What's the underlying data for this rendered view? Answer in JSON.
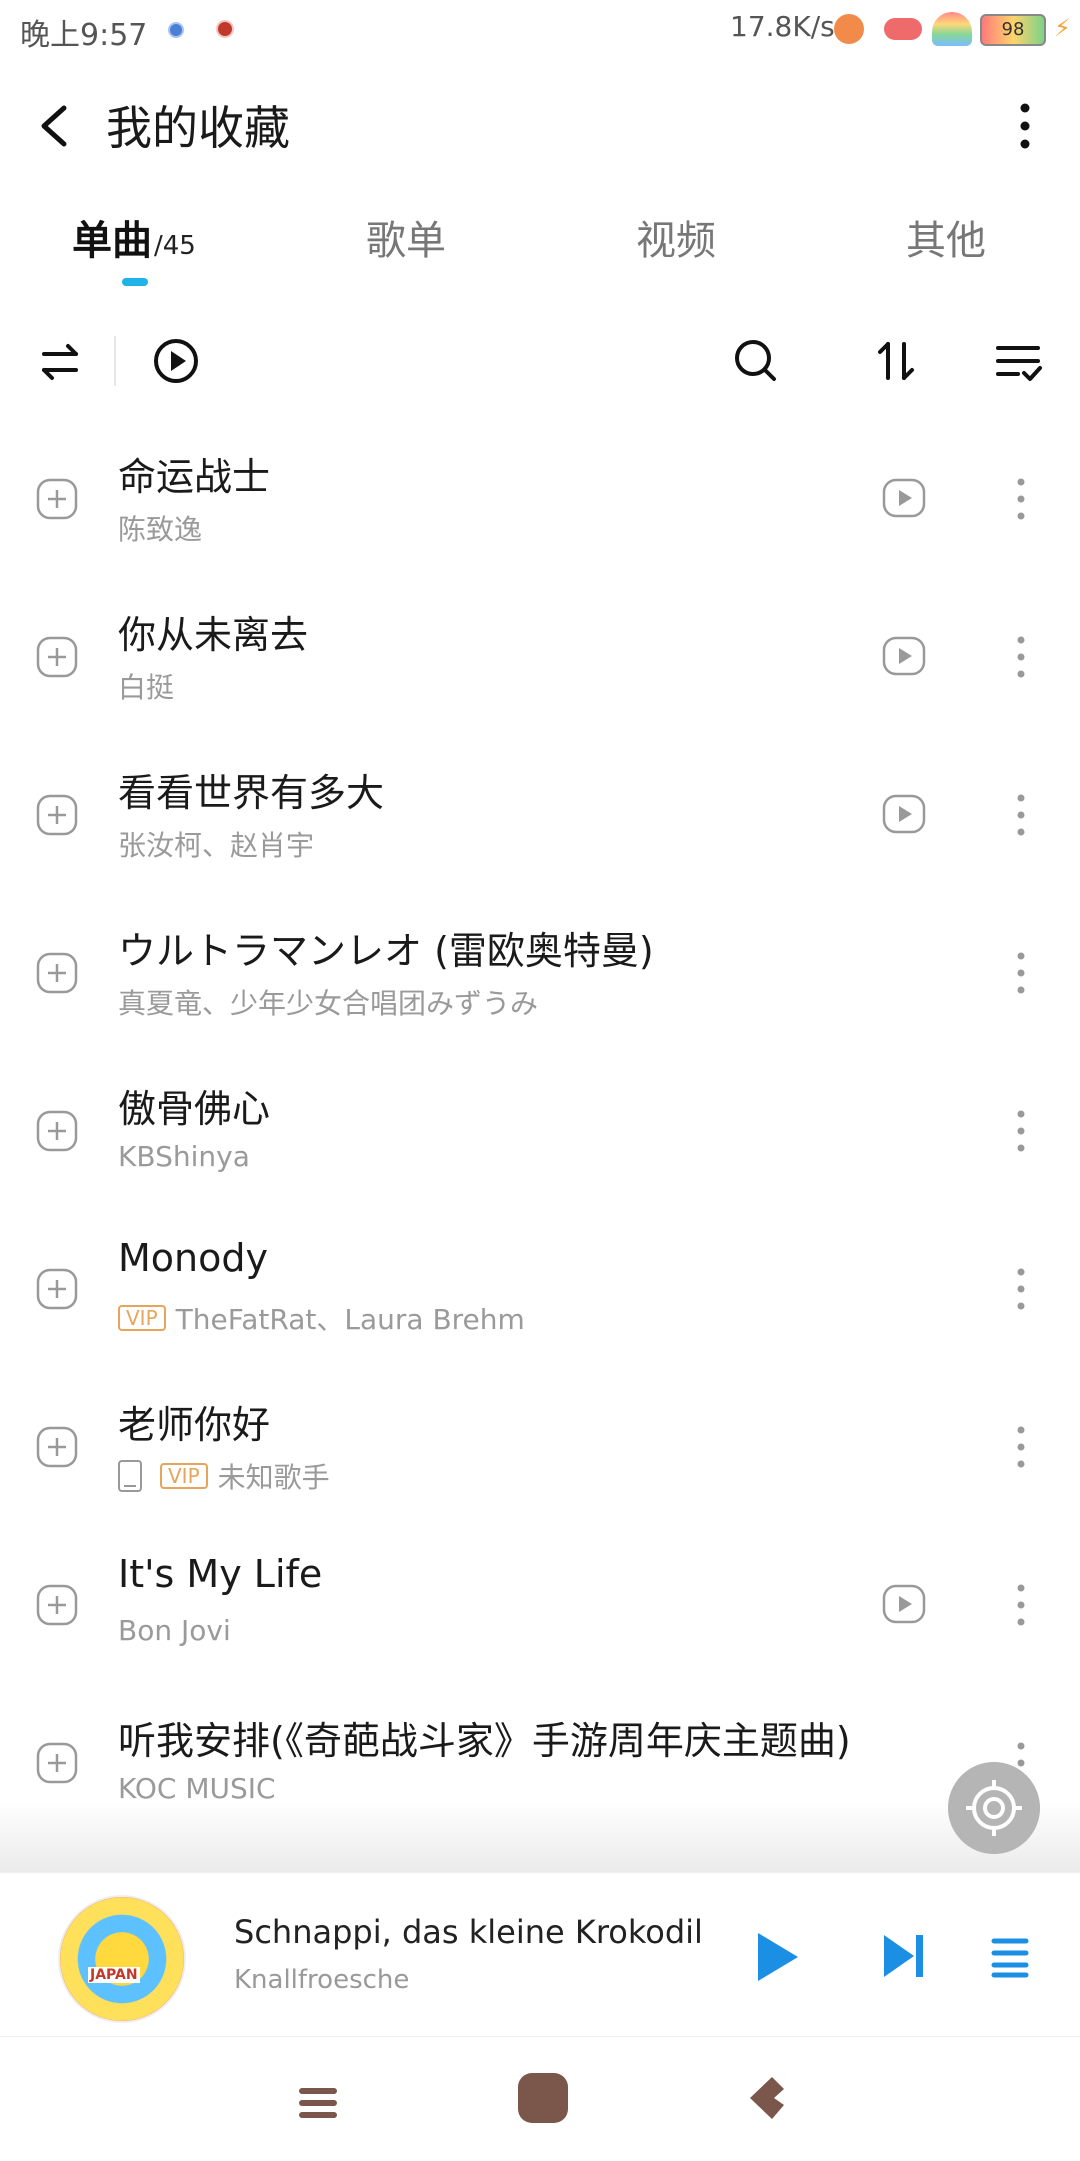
{
  "status_bar": {
    "time": "晚上9:57",
    "net_speed": "17.8K/s",
    "battery": "98"
  },
  "header": {
    "title": "我的收藏",
    "back_icon": "back-arrow-icon",
    "more_icon": "more-vertical-icon"
  },
  "tabs": [
    {
      "label": "单曲",
      "count": "/45",
      "active": true
    },
    {
      "label": "歌单"
    },
    {
      "label": "视频"
    },
    {
      "label": "其他"
    }
  ],
  "accent_color": "#1fb3e8",
  "toolbar": {
    "icons": [
      "shuffle-icon",
      "play-all-icon",
      "search-icon",
      "sort-icon",
      "multi-select-icon"
    ]
  },
  "songs": [
    {
      "title": "命运战士",
      "artist": "陈致逸",
      "has_mv": true
    },
    {
      "title": "你从未离去",
      "artist": "白挺",
      "has_mv": true
    },
    {
      "title": "看看世界有多大",
      "artist": "张汝柯、赵肖宇",
      "has_mv": true
    },
    {
      "title": "ウルトラマンレオ (雷欧奥特曼)",
      "artist": "真夏竜、少年少女合唱团みずうみ",
      "has_mv": false
    },
    {
      "title": "傲骨佛心",
      "artist": "KBShinya",
      "has_mv": false
    },
    {
      "title": "Monody",
      "artist": "TheFatRat、Laura Brehm",
      "vip": "VIP",
      "has_mv": false
    },
    {
      "title": "老师你好",
      "artist": "未知歌手",
      "vip": "VIP",
      "local": true,
      "has_mv": false
    },
    {
      "title": "It's My Life",
      "artist": "Bon Jovi",
      "has_mv": true
    },
    {
      "title": "听我安排(《奇葩战斗家》手游周年庆主题曲)",
      "artist": "KOC MUSIC",
      "has_mv": false
    }
  ],
  "now_playing": {
    "title": "Schnappi, das kleine Krokodil",
    "artist": "Knallfroesche",
    "album_art_text": "JAPAN"
  },
  "nav_bar": {
    "icons": [
      "menu-icon",
      "home-icon",
      "back-icon"
    ],
    "color": "#7b574b"
  }
}
